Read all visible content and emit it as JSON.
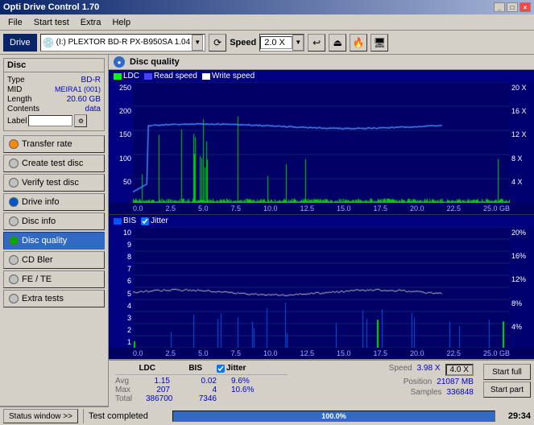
{
  "window": {
    "title": "Opti Drive Control 1.70",
    "controls": [
      "_",
      "□",
      "×"
    ]
  },
  "menu": {
    "items": [
      "File",
      "Start test",
      "Extra",
      "Help"
    ]
  },
  "toolbar": {
    "drive_label": "Drive",
    "drive_icon": "💿",
    "drive_name": "(I:) PLEXTOR BD-R PX-B950SA 1.04",
    "speed_label": "Speed",
    "speed_value": "2.0 X"
  },
  "sidebar": {
    "disc_header": "Disc",
    "disc_type_label": "Type",
    "disc_type_value": "BD-R",
    "disc_mid_label": "MID",
    "disc_mid_value": "MEIRA1 (001)",
    "disc_length_label": "Length",
    "disc_length_value": "20.60 GB",
    "disc_contents_label": "Contents",
    "disc_contents_value": "data",
    "disc_label_label": "Label",
    "buttons": [
      {
        "id": "transfer-rate",
        "label": "Transfer rate",
        "active": false
      },
      {
        "id": "create-test-disc",
        "label": "Create test disc",
        "active": false
      },
      {
        "id": "verify-test-disc",
        "label": "Verify test disc",
        "active": false
      },
      {
        "id": "drive-info",
        "label": "Drive info",
        "active": false
      },
      {
        "id": "disc-info",
        "label": "Disc info",
        "active": false
      },
      {
        "id": "disc-quality",
        "label": "Disc quality",
        "active": true
      },
      {
        "id": "cd-bler",
        "label": "CD Bler",
        "active": false
      },
      {
        "id": "fe-te",
        "label": "FE / TE",
        "active": false
      },
      {
        "id": "extra-tests",
        "label": "Extra tests",
        "active": false
      }
    ]
  },
  "content": {
    "title": "Disc quality",
    "upper_chart": {
      "legend": [
        "LDC",
        "Read speed",
        "Write speed"
      ],
      "y_labels": [
        "250",
        "200",
        "150",
        "100",
        "50"
      ],
      "x_labels": [
        "0.0",
        "2.5",
        "5.0",
        "7.5",
        "10.0",
        "12.5",
        "15.0",
        "17.5",
        "20.0",
        "22.5",
        "25.0 GB"
      ],
      "right_labels": [
        "20 X",
        "16 X",
        "12 X",
        "8 X",
        "4 X"
      ]
    },
    "lower_chart": {
      "title": "BIS",
      "title2": "Jitter",
      "legend": [
        "BIS",
        "Jitter"
      ],
      "y_labels": [
        "10",
        "9",
        "8",
        "7",
        "6",
        "5",
        "4",
        "3",
        "2",
        "1"
      ],
      "x_labels": [
        "0.0",
        "2.5",
        "5.0",
        "7.5",
        "10.0",
        "12.5",
        "15.0",
        "17.5",
        "20.0",
        "22.5",
        "25.0 GB"
      ],
      "right_labels": [
        "20%",
        "16%",
        "12%",
        "8%",
        "4%"
      ]
    }
  },
  "stats": {
    "columns": [
      "LDC",
      "BIS",
      "Jitter"
    ],
    "jitter_checked": true,
    "avg_label": "Avg",
    "avg_ldc": "1.15",
    "avg_bis": "0.02",
    "avg_jitter": "9.6%",
    "max_label": "Max",
    "max_ldc": "207",
    "max_bis": "4",
    "max_jitter": "10.6%",
    "total_label": "Total",
    "total_ldc": "386700",
    "total_bis": "7346",
    "speed_label": "Speed",
    "speed_value": "3.98 X",
    "speed_box": "4.0 X",
    "position_label": "Position",
    "position_value": "21087 MB",
    "samples_label": "Samples",
    "samples_value": "336848",
    "start_full": "Start full",
    "start_part": "Start part"
  },
  "statusbar": {
    "window_btn": "Status window >>",
    "status_text": "Test completed",
    "progress": 100.0,
    "progress_text": "100.0%",
    "time": "29:34"
  }
}
